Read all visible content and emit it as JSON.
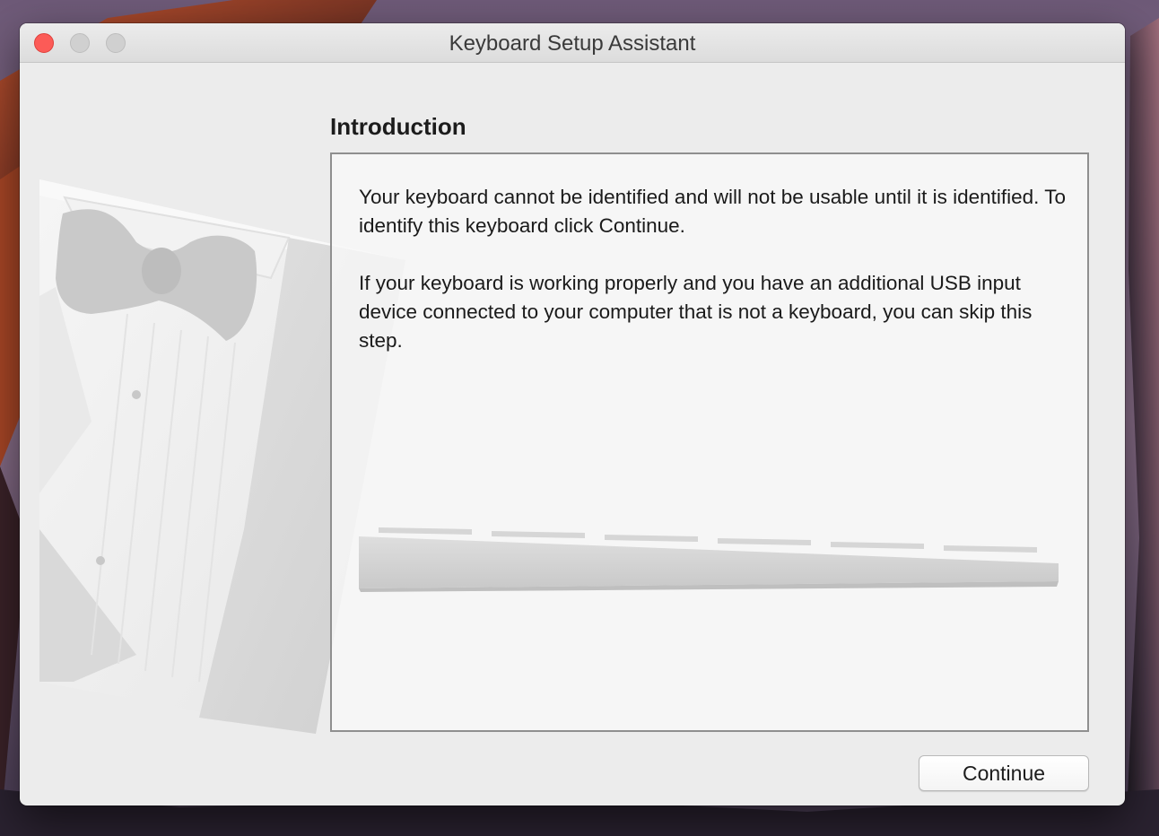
{
  "window": {
    "title": "Keyboard Setup Assistant",
    "controls": [
      "close",
      "minimize",
      "zoom"
    ]
  },
  "section": {
    "heading": "Introduction"
  },
  "body": {
    "paragraph1": "Your keyboard cannot be identified and will not be usable until it is identified. To identify this keyboard click Continue.",
    "paragraph2": "If your keyboard is working properly and you have an additional USB input device connected to your computer that is not a keyboard, you can skip this step."
  },
  "buttons": {
    "continue_label": "Continue"
  },
  "icons": {
    "close": "close-icon",
    "minimize": "minimize-icon",
    "zoom": "zoom-icon",
    "tuxedo": "tuxedo-illustration",
    "keyboard": "keyboard-illustration"
  },
  "colors": {
    "close_button": "#fc5b57",
    "window_background": "#ececec",
    "panel_border": "#8f8f8f"
  }
}
